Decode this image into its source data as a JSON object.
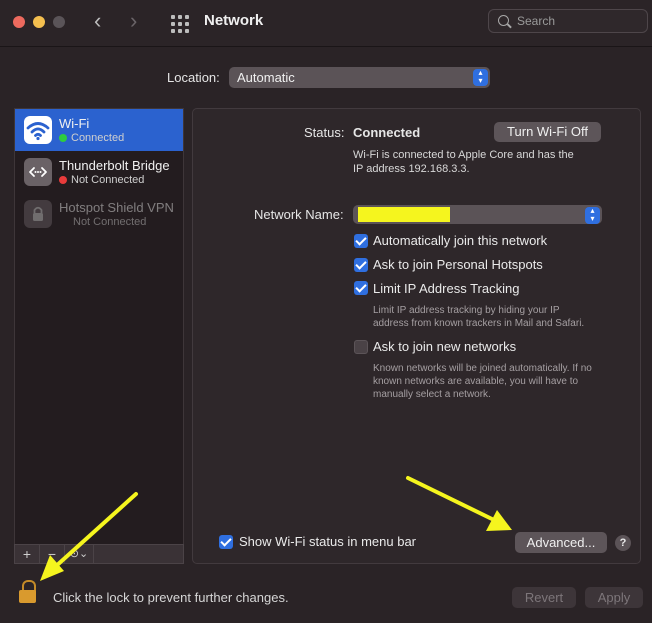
{
  "window": {
    "title": "Network",
    "search_placeholder": "Search"
  },
  "location": {
    "label": "Location:",
    "value": "Automatic"
  },
  "sidebar": {
    "services": [
      {
        "name": "Wi-Fi",
        "status": "Connected",
        "status_color": "#2ecc40",
        "icon": "wifi-icon",
        "selected": true
      },
      {
        "name": "Thunderbolt Bridge",
        "status": "Not Connected",
        "status_color": "#e83b3b",
        "icon": "thunderbolt-bridge-icon",
        "selected": false
      },
      {
        "name": "Hotspot Shield VPN",
        "status": "Not Connected",
        "icon": "vpn-lock-icon",
        "selected": false,
        "disabled": true
      }
    ],
    "buttons": {
      "add": "+",
      "remove": "−",
      "action": "⊙⌄"
    }
  },
  "detail": {
    "status_label": "Status:",
    "status_value": "Connected",
    "turn_off_button": "Turn Wi-Fi Off",
    "status_desc_line1": "Wi-Fi is connected to Apple Core and has the",
    "status_desc_line2": "IP address 192.168.3.3.",
    "network_name_label": "Network Name:",
    "options": [
      {
        "label": "Automatically join this network",
        "checked": true
      },
      {
        "label": "Ask to join Personal Hotspots",
        "checked": true
      },
      {
        "label": "Limit IP Address Tracking",
        "checked": true
      },
      {
        "label": "Ask to join new networks",
        "checked": false
      }
    ],
    "limit_ip_desc_line1": "Limit IP address tracking by hiding your IP",
    "limit_ip_desc_line2": "address from known trackers in Mail and Safari.",
    "known_networks_desc_line1": "Known networks will be joined automatically. If no",
    "known_networks_desc_line2": "known networks are available, you will have to",
    "known_networks_desc_line3": "manually select a network.",
    "show_status_label": "Show Wi-Fi status in menu bar",
    "show_status_checked": true,
    "advanced_button": "Advanced...",
    "help_button": "?"
  },
  "footer": {
    "lock_text": "Click the lock to prevent further changes.",
    "revert_button": "Revert",
    "apply_button": "Apply"
  },
  "colors": {
    "accent": "#2f6fe0",
    "annotation_arrow": "#f5f51e",
    "lock": "#d99a2e"
  }
}
